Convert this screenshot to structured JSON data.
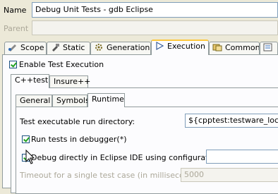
{
  "header": {
    "name_label": "Name",
    "name_value": "Debug Unit Tests - gdb Eclipse",
    "parent_label": "Parent",
    "parent_value": ""
  },
  "tabs": [
    {
      "label": "Scope",
      "icon": "scope-icon"
    },
    {
      "label": "Static",
      "icon": "static-icon"
    },
    {
      "label": "Generation",
      "icon": "generation-icon"
    },
    {
      "label": "Execution",
      "icon": "execution-icon",
      "active": true
    },
    {
      "label": "Common",
      "icon": "common-icon"
    },
    {
      "label": "",
      "icon": "more-icon"
    }
  ],
  "execution": {
    "enable_label": "Enable Test Execution",
    "enable_checked": true
  },
  "lang_tabs": [
    "C++test",
    "Insure++"
  ],
  "sub_tabs": [
    "General",
    "Symbols",
    "Runtime"
  ],
  "runtime": {
    "run_dir_label": "Test executable run directory:",
    "run_dir_value": "${cpptest:testware_loc}",
    "run_in_debugger_label": "Run tests in debugger(*)",
    "debug_eclipse_label": "Debug directly in Eclipse IDE using configuration:",
    "debug_config_value": "",
    "timeout_label": "Timeout for a single test case (in milliseconds):",
    "timeout_value": "5000"
  },
  "colors": {
    "active_tab_accent": "#ffc83c",
    "check_green": "#21a121",
    "window_bg": "#ece9d8"
  }
}
